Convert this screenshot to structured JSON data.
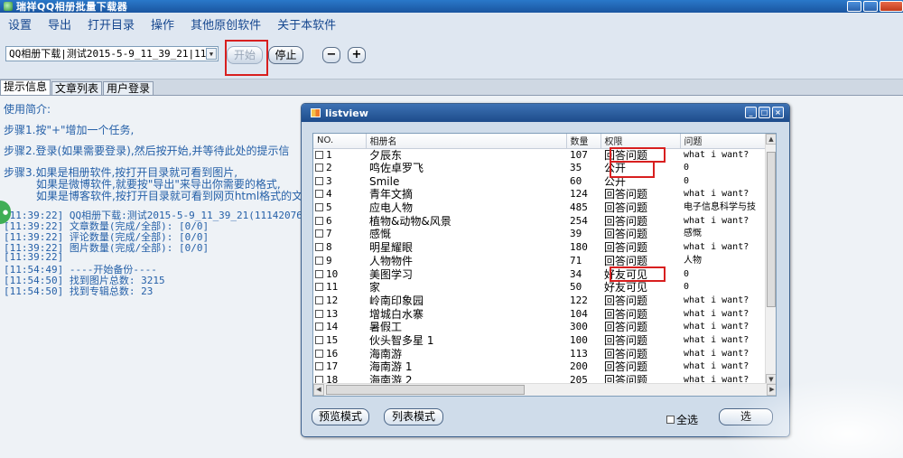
{
  "window": {
    "title": "瑞祥QQ相册批量下载器"
  },
  "menu": [
    "设置",
    "导出",
    "打开目录",
    "操作",
    "其他原创软件",
    "关于本软件"
  ],
  "toolbar": {
    "task_value": "QQ相册下载|测试2015-5-9_11_39_21|11",
    "start_label": "开始",
    "stop_label": "停止",
    "minus_label": "−",
    "plus_label": "+"
  },
  "tabs": [
    "提示信息",
    "文章列表",
    "用户登录"
  ],
  "log": {
    "intro": "使用简介:",
    "step1": "步骤1.按\"+\"增加一个任务,",
    "step2": "步骤2.登录(如果需要登录),然后按开始,并等待此处的提示信",
    "step3a": "步骤3.如果是相册软件,按打开目录就可看到图片,",
    "step3b": "如果是微博软件,就要按\"导出\"来导出你需要的格式,",
    "step3c": "如果是博客软件,按打开目录就可看到网页html格式的文",
    "lines": [
      "[11:39:22] QQ相册下载:测试2015-5-9_11_39_21(1114207644)",
      "[11:39:22] 文章数量(完成/全部): [0/0]",
      "[11:39:22] 评论数量(完成/全部): [0/0]",
      "[11:39:22] 图片数量(完成/全部): [0/0]",
      "[11:39:22]",
      "[11:54:49] ----开始备份----",
      "[11:54:50] 找到图片总数: 3215",
      "[11:54:50] 找到专辑总数: 23"
    ]
  },
  "listview": {
    "title": "listview",
    "columns": [
      "NO.",
      "相册名",
      "数量",
      "权限",
      "问题"
    ],
    "rows": [
      [
        "1",
        "夕辰东",
        "107",
        "回答问题",
        "what i want?"
      ],
      [
        "2",
        "鸣佐卓罗飞",
        "35",
        "公开",
        "0"
      ],
      [
        "3",
        "Smile",
        "60",
        "公开",
        "0"
      ],
      [
        "4",
        "青年文摘",
        "124",
        "回答问题",
        "what i want?"
      ],
      [
        "5",
        "应电人物",
        "485",
        "回答问题",
        "电子信息科学与技"
      ],
      [
        "6",
        "植物&动物&风景",
        "254",
        "回答问题",
        "what i want?"
      ],
      [
        "7",
        "感慨",
        "39",
        "回答问题",
        "感慨"
      ],
      [
        "8",
        "明星耀眼",
        "180",
        "回答问题",
        "what i want?"
      ],
      [
        "9",
        "人物物件",
        "71",
        "回答问题",
        "人物"
      ],
      [
        "10",
        "美图学习",
        "34",
        "好友可见",
        "0"
      ],
      [
        "11",
        "家",
        "50",
        "好友可见",
        "0"
      ],
      [
        "12",
        "岭南印象园",
        "122",
        "回答问题",
        "what i want?"
      ],
      [
        "13",
        "增城白水寨",
        "104",
        "回答问题",
        "what i want?"
      ],
      [
        "14",
        "暑假工",
        "300",
        "回答问题",
        "what i want?"
      ],
      [
        "15",
        "伙头智多星 1",
        "100",
        "回答问题",
        "what i want?"
      ],
      [
        "16",
        "海南游",
        "113",
        "回答问题",
        "what i want?"
      ],
      [
        "17",
        "海南游 1",
        "200",
        "回答问题",
        "what i want?"
      ],
      [
        "18",
        "海南游 2",
        "205",
        "回答问题",
        "what i want?"
      ]
    ],
    "preview_mode_label": "预览模式",
    "list_mode_label": "列表模式",
    "select_all_label": "全选",
    "select_button_label": "选"
  }
}
